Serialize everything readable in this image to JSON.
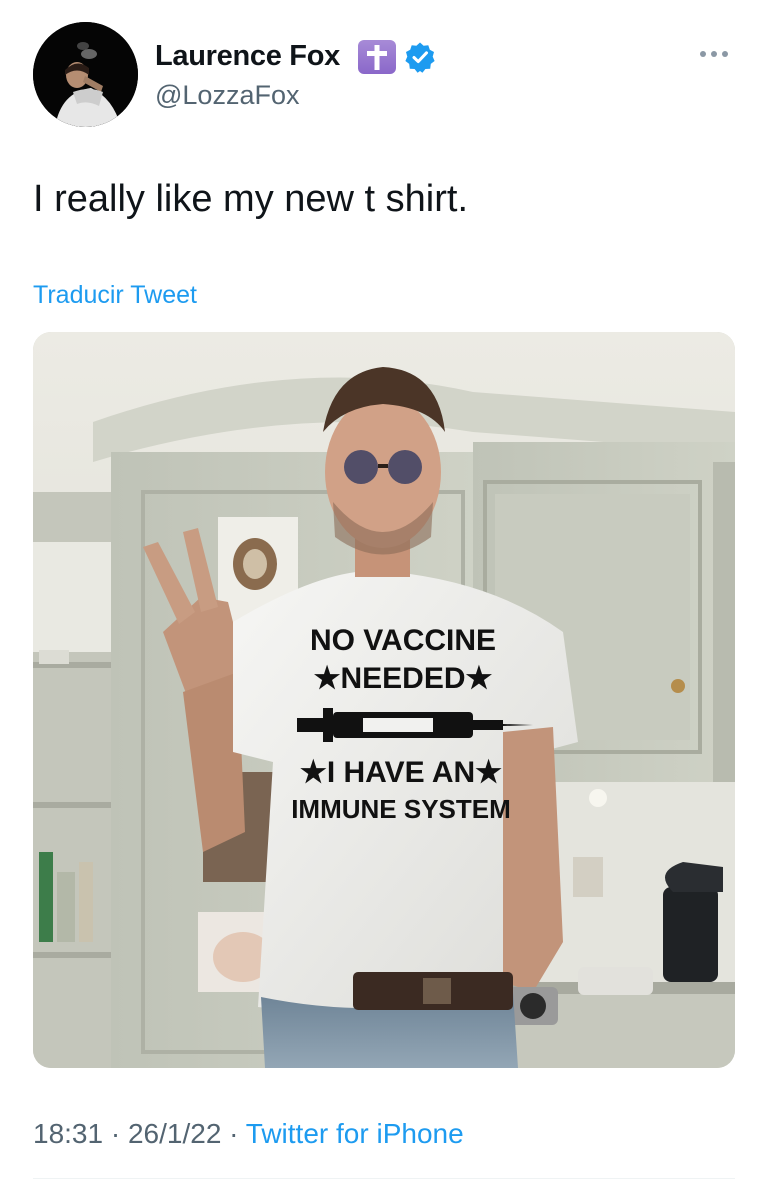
{
  "author": {
    "display_name": "Laurence Fox",
    "handle": "@LozzaFox",
    "badge_icon": "latin-cross-icon",
    "verified_icon": "verified-badge-icon",
    "verified_color": "#1d9bf0"
  },
  "tweet": {
    "text": "I really like my new t shirt.",
    "translate_label": "Traducir Tweet",
    "time": "18:31",
    "separator": " · ",
    "date": "26/1/22",
    "source": "Twitter for iPhone"
  },
  "media": {
    "shirt_print": {
      "line1": "NO VACCINE",
      "line2": "★NEEDED★",
      "line3": "★I HAVE AN★",
      "line4": "IMMUNE SYSTEM"
    }
  },
  "colors": {
    "link": "#1d9bf0",
    "secondary_text": "#536471",
    "primary_text": "#0f1419"
  }
}
